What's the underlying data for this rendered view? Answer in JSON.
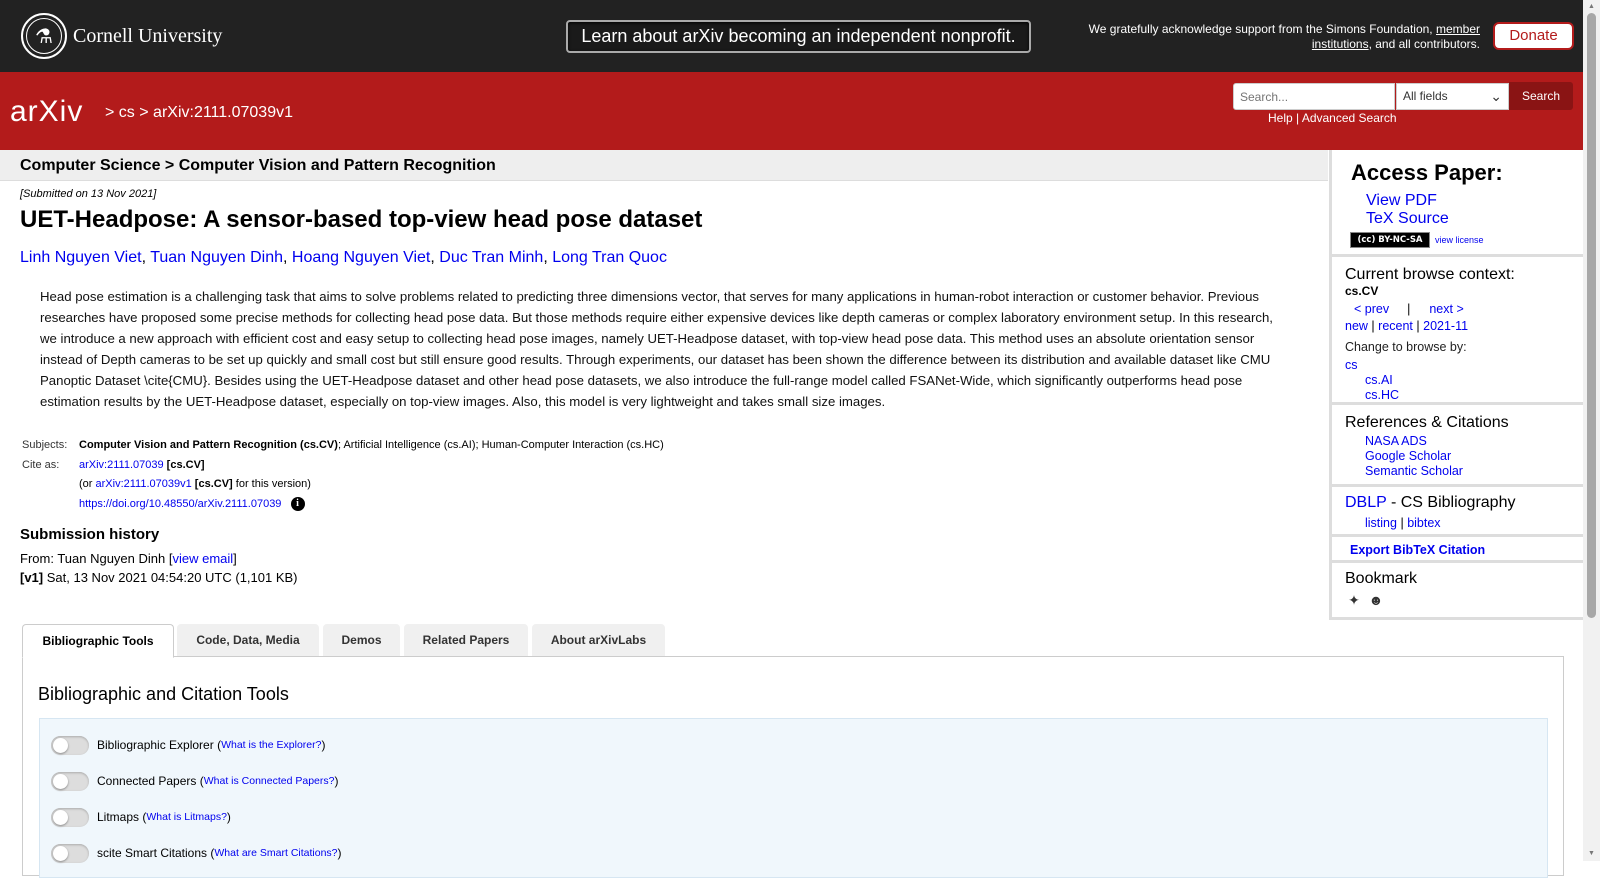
{
  "banner": {
    "university": "Cornell University",
    "nonprofit_text": "Learn about arXiv becoming an independent nonprofit.",
    "support_text": "We gratefully acknowledge support from the Simons Foundation,",
    "support_link": "member institutions",
    "support_tail": ", and all contributors.",
    "donate_label": "Donate"
  },
  "header": {
    "logo_text": "arXiv",
    "crumb_sep": ">",
    "crumb_cs": "cs",
    "crumb_id": "arXiv:2111.07039v1",
    "search_placeholder": "Search...",
    "field_select": "All fields",
    "search_button": "Search",
    "help_link": "Help",
    "help_sep": "|",
    "advanced_link": "Advanced Search"
  },
  "paper": {
    "category": "Computer Science > Computer Vision and Pattern Recognition",
    "submitted": "[Submitted on 13 Nov 2021]",
    "title": "UET-Headpose: A sensor-based top-view head pose dataset",
    "authors": [
      "Linh Nguyen Viet",
      "Tuan Nguyen Dinh",
      "Hoang Nguyen Viet",
      "Duc Tran Minh",
      "Long Tran Quoc"
    ],
    "abstract": "Head pose estimation is a challenging task that aims to solve problems related to predicting three dimensions vector, that serves for many applications in human-robot interaction or customer behavior. Previous researches have proposed some precise methods for collecting head pose data. But those methods require either expensive devices like depth cameras or complex laboratory environment setup. In this research, we introduce a new approach with efficient cost and easy setup to collecting head pose images, namely UET-Headpose dataset, with top-view head pose data. This method uses an absolute orientation sensor instead of Depth cameras to be set up quickly and small cost but still ensure good results. Through experiments, our dataset has been shown the difference between its distribution and available dataset like CMU Panoptic Dataset \\cite{CMU}. Besides using the UET-Headpose dataset and other head pose datasets, we also introduce the full-range model called FSANet-Wide, which significantly outperforms head pose estimation results by the UET-Headpose dataset, especially on top-view images. Also, this model is very lightweight and takes small size images.",
    "subjects_label": "Subjects:",
    "subjects_primary": "Computer Vision and Pattern Recognition (cs.CV)",
    "subjects_rest": "; Artificial Intelligence (cs.AI); Human-Computer Interaction (cs.HC)",
    "cite_label": "Cite as:",
    "cite_id": "arXiv:2111.07039",
    "cite_cat": "[cs.CV]",
    "cite_or": "(or",
    "cite_version": "arXiv:2111.07039v1",
    "cite_version_tail": "for this version)",
    "doi": "https://doi.org/10.48550/arXiv.2111.07039",
    "doi_info_icon": "i"
  },
  "history": {
    "heading": "Submission history",
    "from": "From: Tuan Nguyen Dinh [",
    "view_email": "view email",
    "from_close": "]",
    "v1_label": "[v1]",
    "v1_text": "Sat, 13 Nov 2021 04:54:20 UTC (1,101 KB)"
  },
  "tabs": [
    "Bibliographic Tools",
    "Code, Data, Media",
    "Demos",
    "Related Papers",
    "About arXivLabs"
  ],
  "tools": {
    "heading": "Bibliographic and Citation Tools",
    "items": [
      {
        "name": "Bibliographic Explorer",
        "help": "What is the Explorer?"
      },
      {
        "name": "Connected Papers",
        "help": "What is Connected Papers?"
      },
      {
        "name": "Litmaps",
        "help": "What is Litmaps?"
      },
      {
        "name": "scite Smart Citations",
        "help": "What are Smart Citations?"
      }
    ]
  },
  "sidebar": {
    "access_heading": "Access Paper:",
    "view_pdf": "View PDF",
    "tex_source": "TeX Source",
    "license_badge": "(cc) BY-NC-SA",
    "view_license": "view license",
    "context_heading": "Current browse context:",
    "context_current": "cs.CV",
    "prev": "< prev",
    "nav_sep": "|",
    "next": "next >",
    "new": "new",
    "recent": "recent",
    "month": "2021-11",
    "change_label": "Change to browse by:",
    "browse_cs": "cs",
    "browse_ai": "cs.AI",
    "browse_hc": "cs.HC",
    "refs_heading": "References & Citations",
    "refs": [
      "NASA ADS",
      "Google Scholar",
      "Semantic Scholar"
    ],
    "dblp_link": "DBLP",
    "dblp_tail": " - CS Bibliography",
    "listing": "listing",
    "bibtex": "bibtex",
    "export": "Export BibTeX Citation",
    "bookmark_heading": "Bookmark"
  }
}
